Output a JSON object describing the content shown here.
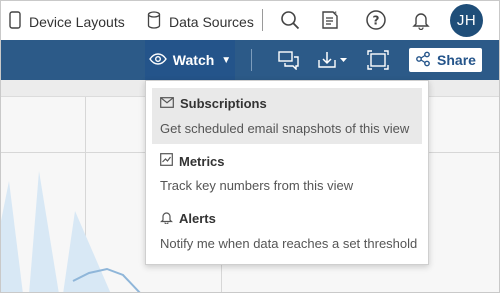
{
  "topbar": {
    "device_layouts": "Device Layouts",
    "data_sources": "Data Sources",
    "icons": [
      "search-icon",
      "notes-icon",
      "help-icon",
      "bell-icon"
    ],
    "avatar_initials": "JH"
  },
  "toolbar": {
    "watch_label": "Watch",
    "share_label": "Share",
    "icons": [
      "comments-icon",
      "download-icon",
      "fullscreen-icon"
    ]
  },
  "watch_menu": {
    "items": [
      {
        "icon": "envelope-icon",
        "title": "Subscriptions",
        "description": "Get scheduled email snapshots of this view"
      },
      {
        "icon": "metrics-icon",
        "title": "Metrics",
        "description": "Track key numbers from this view"
      },
      {
        "icon": "bell-icon",
        "title": "Alerts",
        "description": "Notify me when data reaches a set threshold"
      }
    ]
  },
  "colors": {
    "toolbar": "#2c5a88",
    "watch_active": "#24548a",
    "avatar": "#1f4e79",
    "chart_fill": "#d8e8f5",
    "chart_line": "#8fb6d9"
  }
}
